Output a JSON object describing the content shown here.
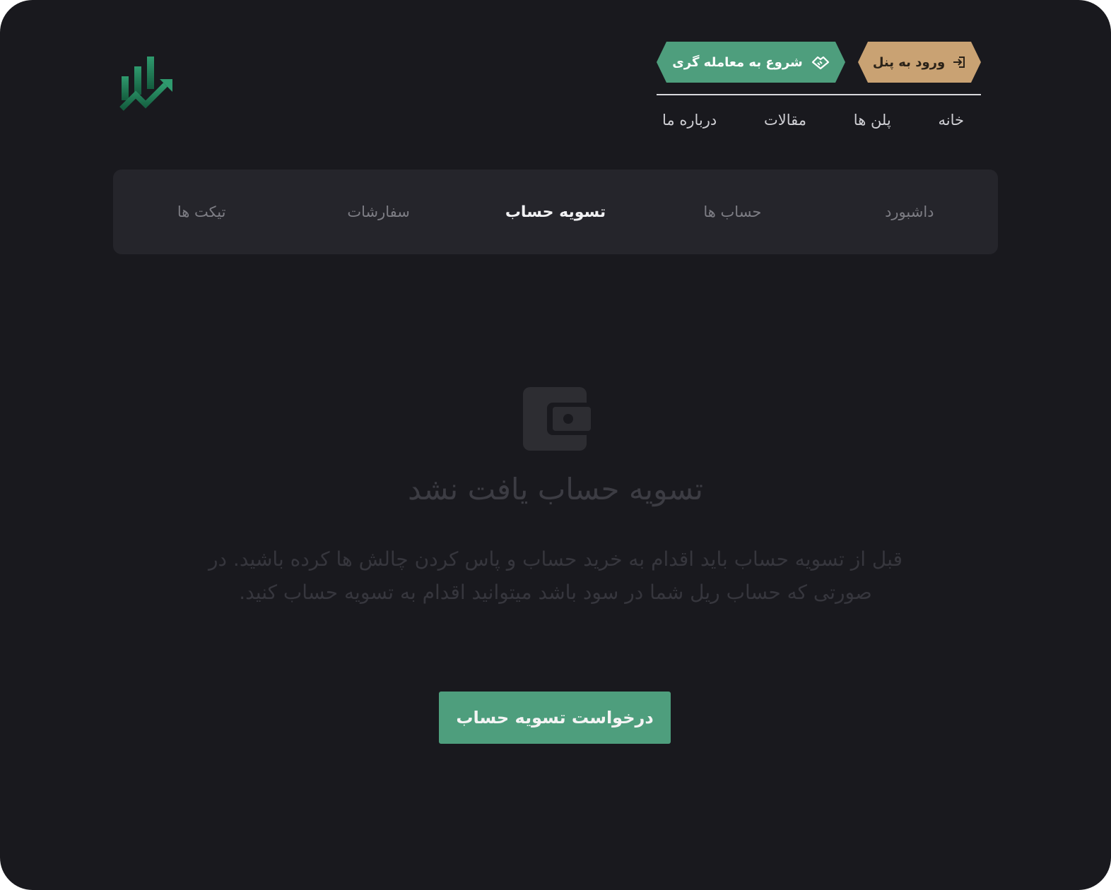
{
  "header": {
    "panel_button": "ورود به پنل",
    "trade_button": "شروع به معامله گری",
    "nav": [
      "خانه",
      "پلن ها",
      "مقالات",
      "درباره ما"
    ]
  },
  "tabs": [
    {
      "label": "داشبورد",
      "active": false
    },
    {
      "label": "حساب ها",
      "active": false
    },
    {
      "label": "تسویه حساب",
      "active": true
    },
    {
      "label": "سفارشات",
      "active": false
    },
    {
      "label": "تیکت ها",
      "active": false
    }
  ],
  "empty_state": {
    "icon": "wallet-icon",
    "title": "تسویه حساب یافت نشد",
    "description": "قبل از تسویه حساب باید اقدام به خرید حساب و پاس کردن چالش ها کرده باشید. در صورتی که حساب ریل شما در سود باشد میتوانید اقدام به تسویه حساب کنید.",
    "button": "درخواست تسویه حساب"
  },
  "colors": {
    "background": "#19191e",
    "tab_bar": "#25252b",
    "green": "#4e9e7d",
    "gold": "#c9a273"
  }
}
